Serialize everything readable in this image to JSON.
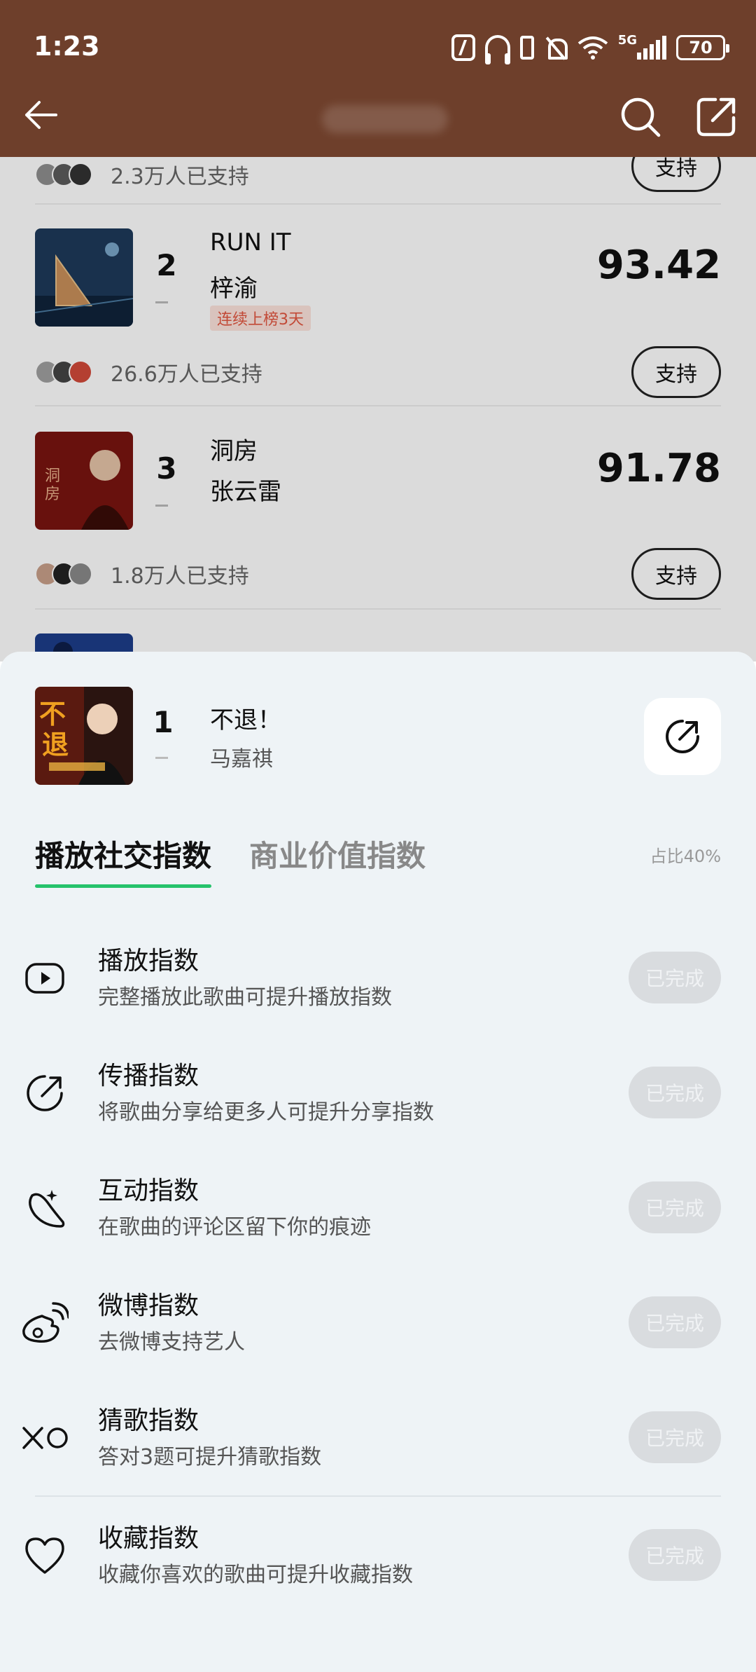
{
  "status_bar": {
    "time": "1:23",
    "network": "5G",
    "battery": "70"
  },
  "colors": {
    "header_bg": "#6e3f2b",
    "tab_accent": "#25c26b",
    "streak_red": "#e2553f"
  },
  "list": {
    "top_support_text": "2.3万人已支持",
    "songs": [
      {
        "rank": "2",
        "title": "RUN IT",
        "artist": "梓渝",
        "badge": "连续上榜3天",
        "score": "93.42",
        "support_text": "26.6万人已支持",
        "support_label": "支持"
      },
      {
        "rank": "3",
        "title": "洞房",
        "artist": "张云雷",
        "score": "91.78",
        "support_text": "1.8万人已支持",
        "support_label": "支持"
      }
    ],
    "top_support_label": "支持"
  },
  "sheet": {
    "rank": "1",
    "title": "不退！",
    "artist": "马嘉祺",
    "tabs": [
      "播放社交指数",
      "商业价值指数"
    ],
    "ratio": "占比40%",
    "tasks": [
      {
        "icon": "play-icon",
        "name": "播放指数",
        "desc": "完整播放此歌曲可提升播放指数",
        "status": "已完成"
      },
      {
        "icon": "share-icon",
        "name": "传播指数",
        "desc": "将歌曲分享给更多人可提升分享指数",
        "status": "已完成"
      },
      {
        "icon": "comment-icon",
        "name": "互动指数",
        "desc": "在歌曲的评论区留下你的痕迹",
        "status": "已完成"
      },
      {
        "icon": "weibo-icon",
        "name": "微博指数",
        "desc": "去微博支持艺人",
        "status": "已完成"
      },
      {
        "icon": "xo-icon",
        "name": "猜歌指数",
        "desc": "答对3题可提升猜歌指数",
        "status": "已完成"
      },
      {
        "icon": "heart-icon",
        "name": "收藏指数",
        "desc": "收藏你喜欢的歌曲可提升收藏指数",
        "status": "已完成"
      }
    ]
  }
}
